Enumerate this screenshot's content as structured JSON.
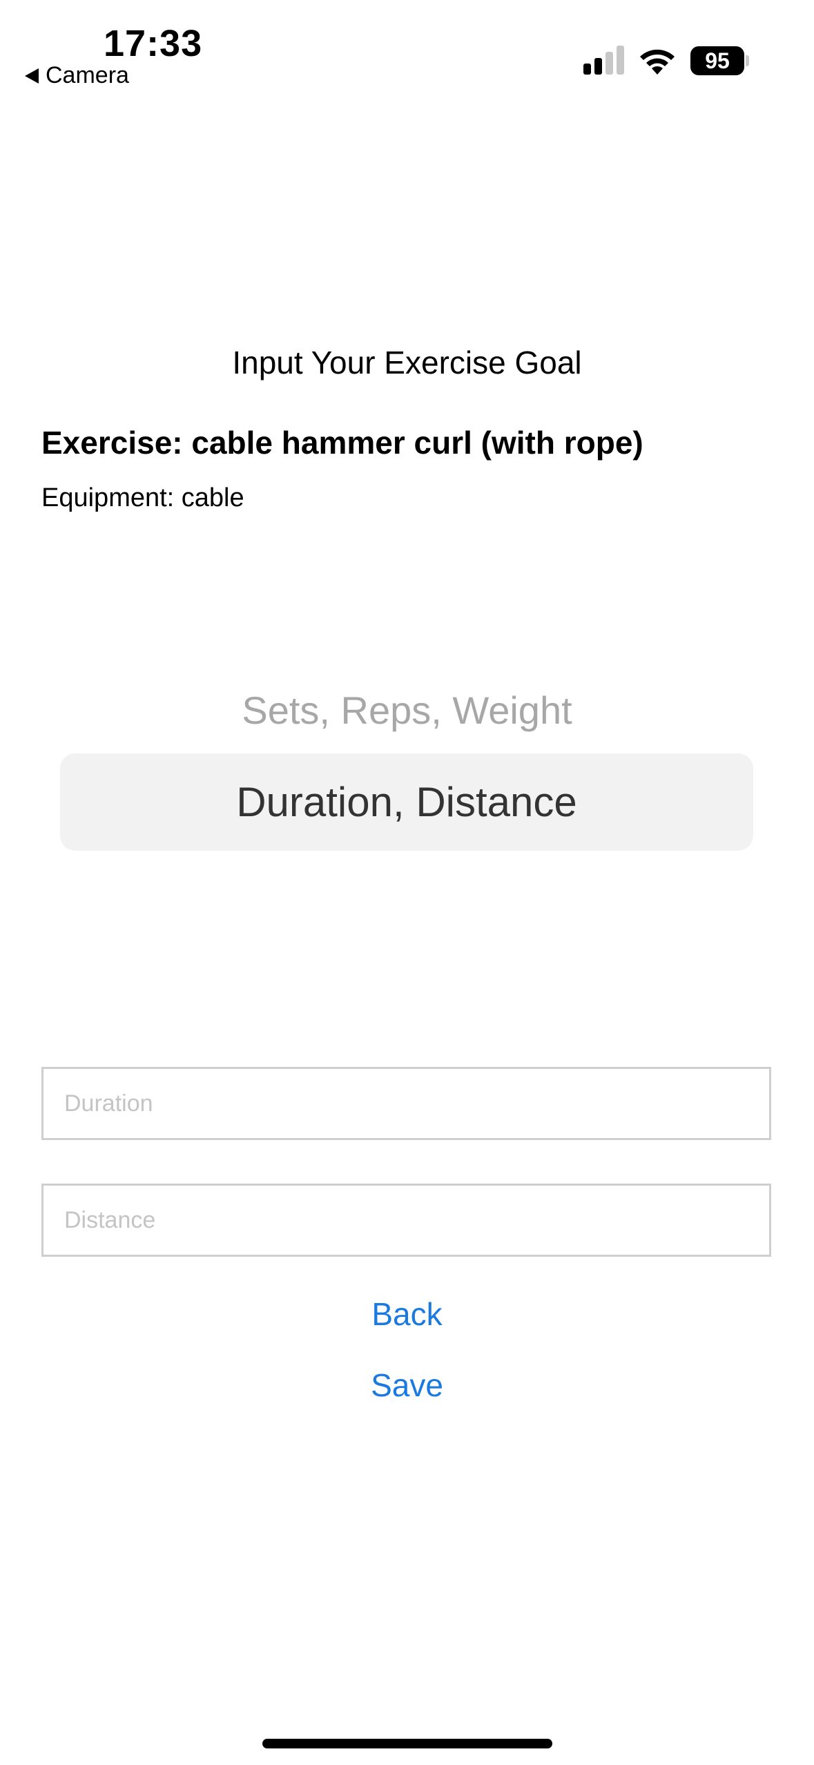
{
  "status_bar": {
    "time": "17:33",
    "back_app": "Camera",
    "battery": "95",
    "signal_icon": "cellular-signal-icon",
    "wifi_icon": "wifi-icon",
    "battery_icon": "battery-icon"
  },
  "page": {
    "title": "Input Your Exercise Goal",
    "exercise": "Exercise: cable hammer curl (with rope)",
    "equipment": "Equipment: cable"
  },
  "picker": {
    "options": [
      "Sets, Reps, Weight",
      "Duration, Distance"
    ],
    "selected": "Duration, Distance"
  },
  "fields": {
    "duration_placeholder": "Duration",
    "distance_placeholder": "Distance"
  },
  "actions": {
    "back_label": "Back",
    "save_label": "Save"
  },
  "colors": {
    "link": "#1a7ae0",
    "picker_highlight": "#f2f2f2",
    "placeholder": "#c4c4c4"
  }
}
